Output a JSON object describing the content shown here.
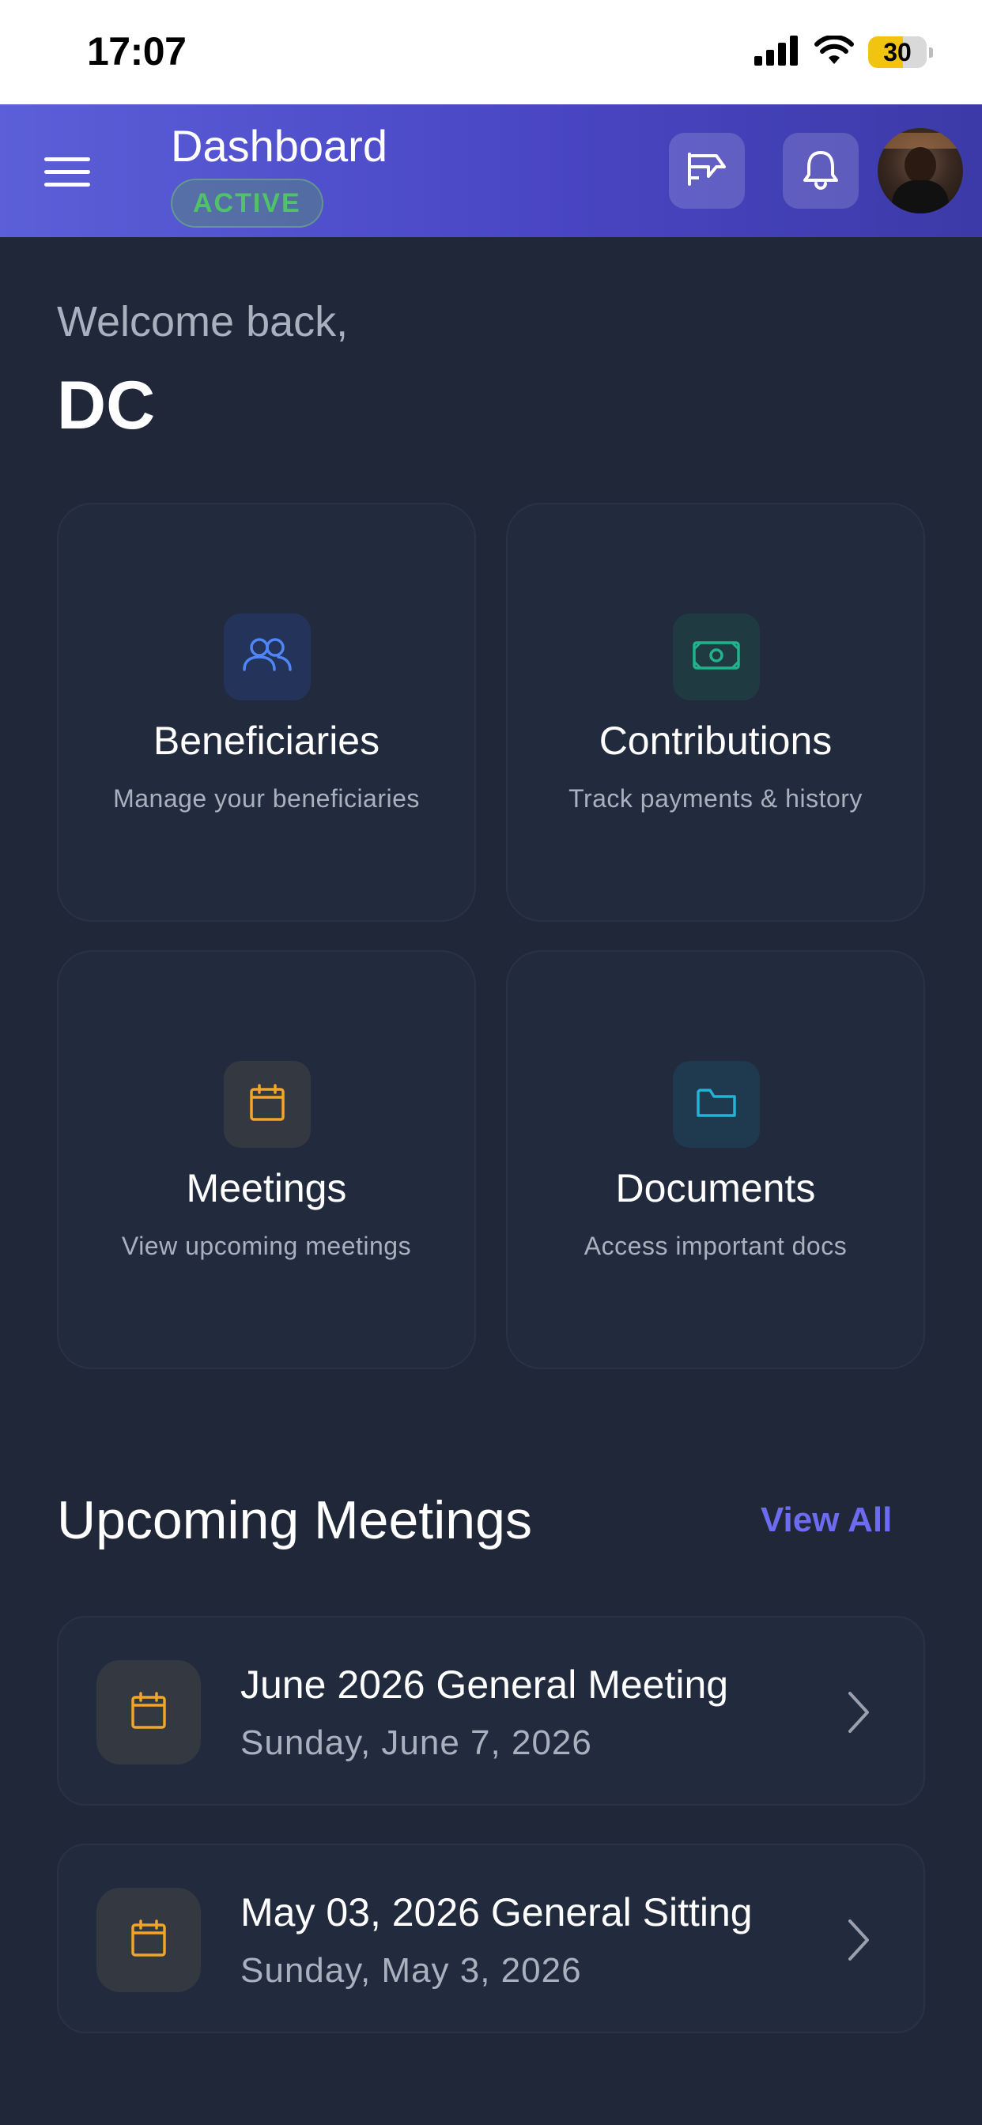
{
  "status_bar": {
    "time": "17:07",
    "battery": "30",
    "icons": [
      "signal-icon",
      "wifi-icon",
      "battery-icon"
    ]
  },
  "header": {
    "title": "Dashboard",
    "status": "ACTIVE",
    "icons": [
      "menu-icon",
      "megaphone-icon",
      "bell-icon",
      "avatar"
    ],
    "gradient": [
      "#5b5fd8",
      "#3c3aa8"
    ]
  },
  "welcome": {
    "greeting": "Welcome back,",
    "name": "DC"
  },
  "cards": [
    {
      "title": "Beneficiaries",
      "description": "Manage your beneficiaries",
      "icon": "users-icon",
      "icon_color": "#4f86f7",
      "icon_bg": "#24335a"
    },
    {
      "title": "Contributions",
      "description": "Track payments & history",
      "icon": "money-icon",
      "icon_color": "#22b38c",
      "icon_bg": "#1f3b41"
    },
    {
      "title": "Meetings",
      "description": "View upcoming meetings",
      "icon": "calendar-icon",
      "icon_color": "#f2a52a",
      "icon_bg": "#343840"
    },
    {
      "title": "Documents",
      "description": "Access important docs",
      "icon": "folder-icon",
      "icon_color": "#1fb5d8",
      "icon_bg": "#1f3a4e"
    }
  ],
  "meetings_section": {
    "title": "Upcoming Meetings",
    "view_all": "View All",
    "items": [
      {
        "title": "June 2026 General Meeting",
        "date": "Sunday, June 7, 2026"
      },
      {
        "title": "May 03, 2026 General Sitting",
        "date": "Sunday, May 3, 2026"
      }
    ]
  },
  "colors": {
    "background": "#1f2738",
    "card": "#222b3d",
    "accent": "#6c6bf2",
    "active_green": "#4fc26a"
  }
}
